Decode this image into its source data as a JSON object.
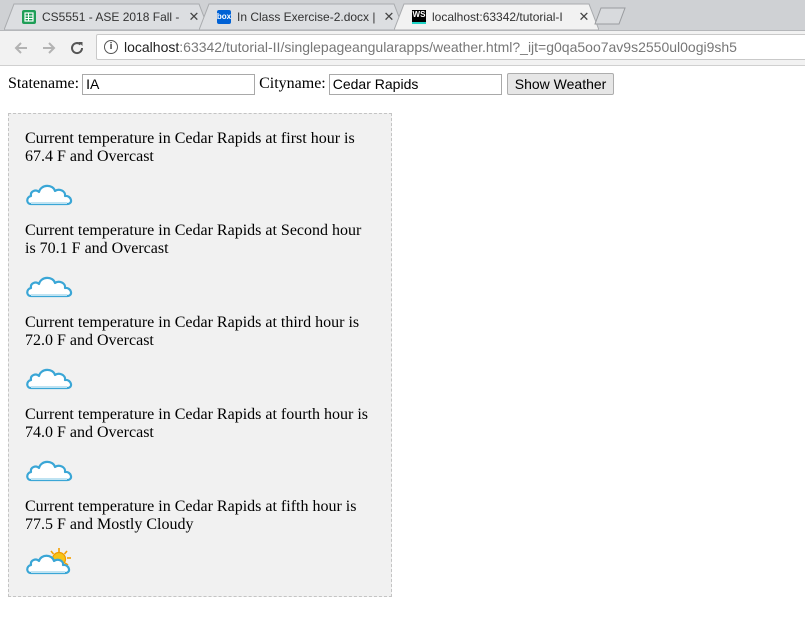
{
  "tabs": [
    {
      "title": "CS5551 - ASE 2018 Fall -",
      "favicon": "sheets-icon",
      "active": false
    },
    {
      "title": "In Class Exercise-2.docx |",
      "favicon": "box-icon",
      "favicon_text": "box",
      "active": false
    },
    {
      "title": "localhost:63342/tutorial-I",
      "favicon": "webstorm-icon",
      "favicon_text": "WS",
      "active": true
    }
  ],
  "tab_close": "✕",
  "address_bar": {
    "host": "localhost",
    "path": ":63342/tutorial-II/singlepageangularapps/weather.html?_ijt=g0qa5oo7av9s2550ul0ogi9sh5"
  },
  "form": {
    "state_label": "Statename:",
    "state_value": "IA",
    "city_label": "Cityname:",
    "city_value": "Cedar Rapids",
    "button_label": "Show Weather"
  },
  "forecast": [
    {
      "text": "Current temperature in Cedar Rapids at first hour is 67.4 F and Overcast",
      "icon": "overcast-cloud-icon"
    },
    {
      "text": "Current temperature in Cedar Rapids at Second hour is 70.1 F and Overcast",
      "icon": "overcast-cloud-icon"
    },
    {
      "text": "Current temperature in Cedar Rapids at third hour is 72.0 F and Overcast",
      "icon": "overcast-cloud-icon"
    },
    {
      "text": "Current temperature in Cedar Rapids at fourth hour is 74.0 F and Overcast",
      "icon": "overcast-cloud-icon"
    },
    {
      "text": "Current temperature in Cedar Rapids at fifth hour is 77.5 F and Mostly Cloudy",
      "icon": "mostly-cloudy-icon"
    }
  ],
  "colors": {
    "cloud_outline": "#3aa6d6",
    "sun": "#f5b400"
  }
}
